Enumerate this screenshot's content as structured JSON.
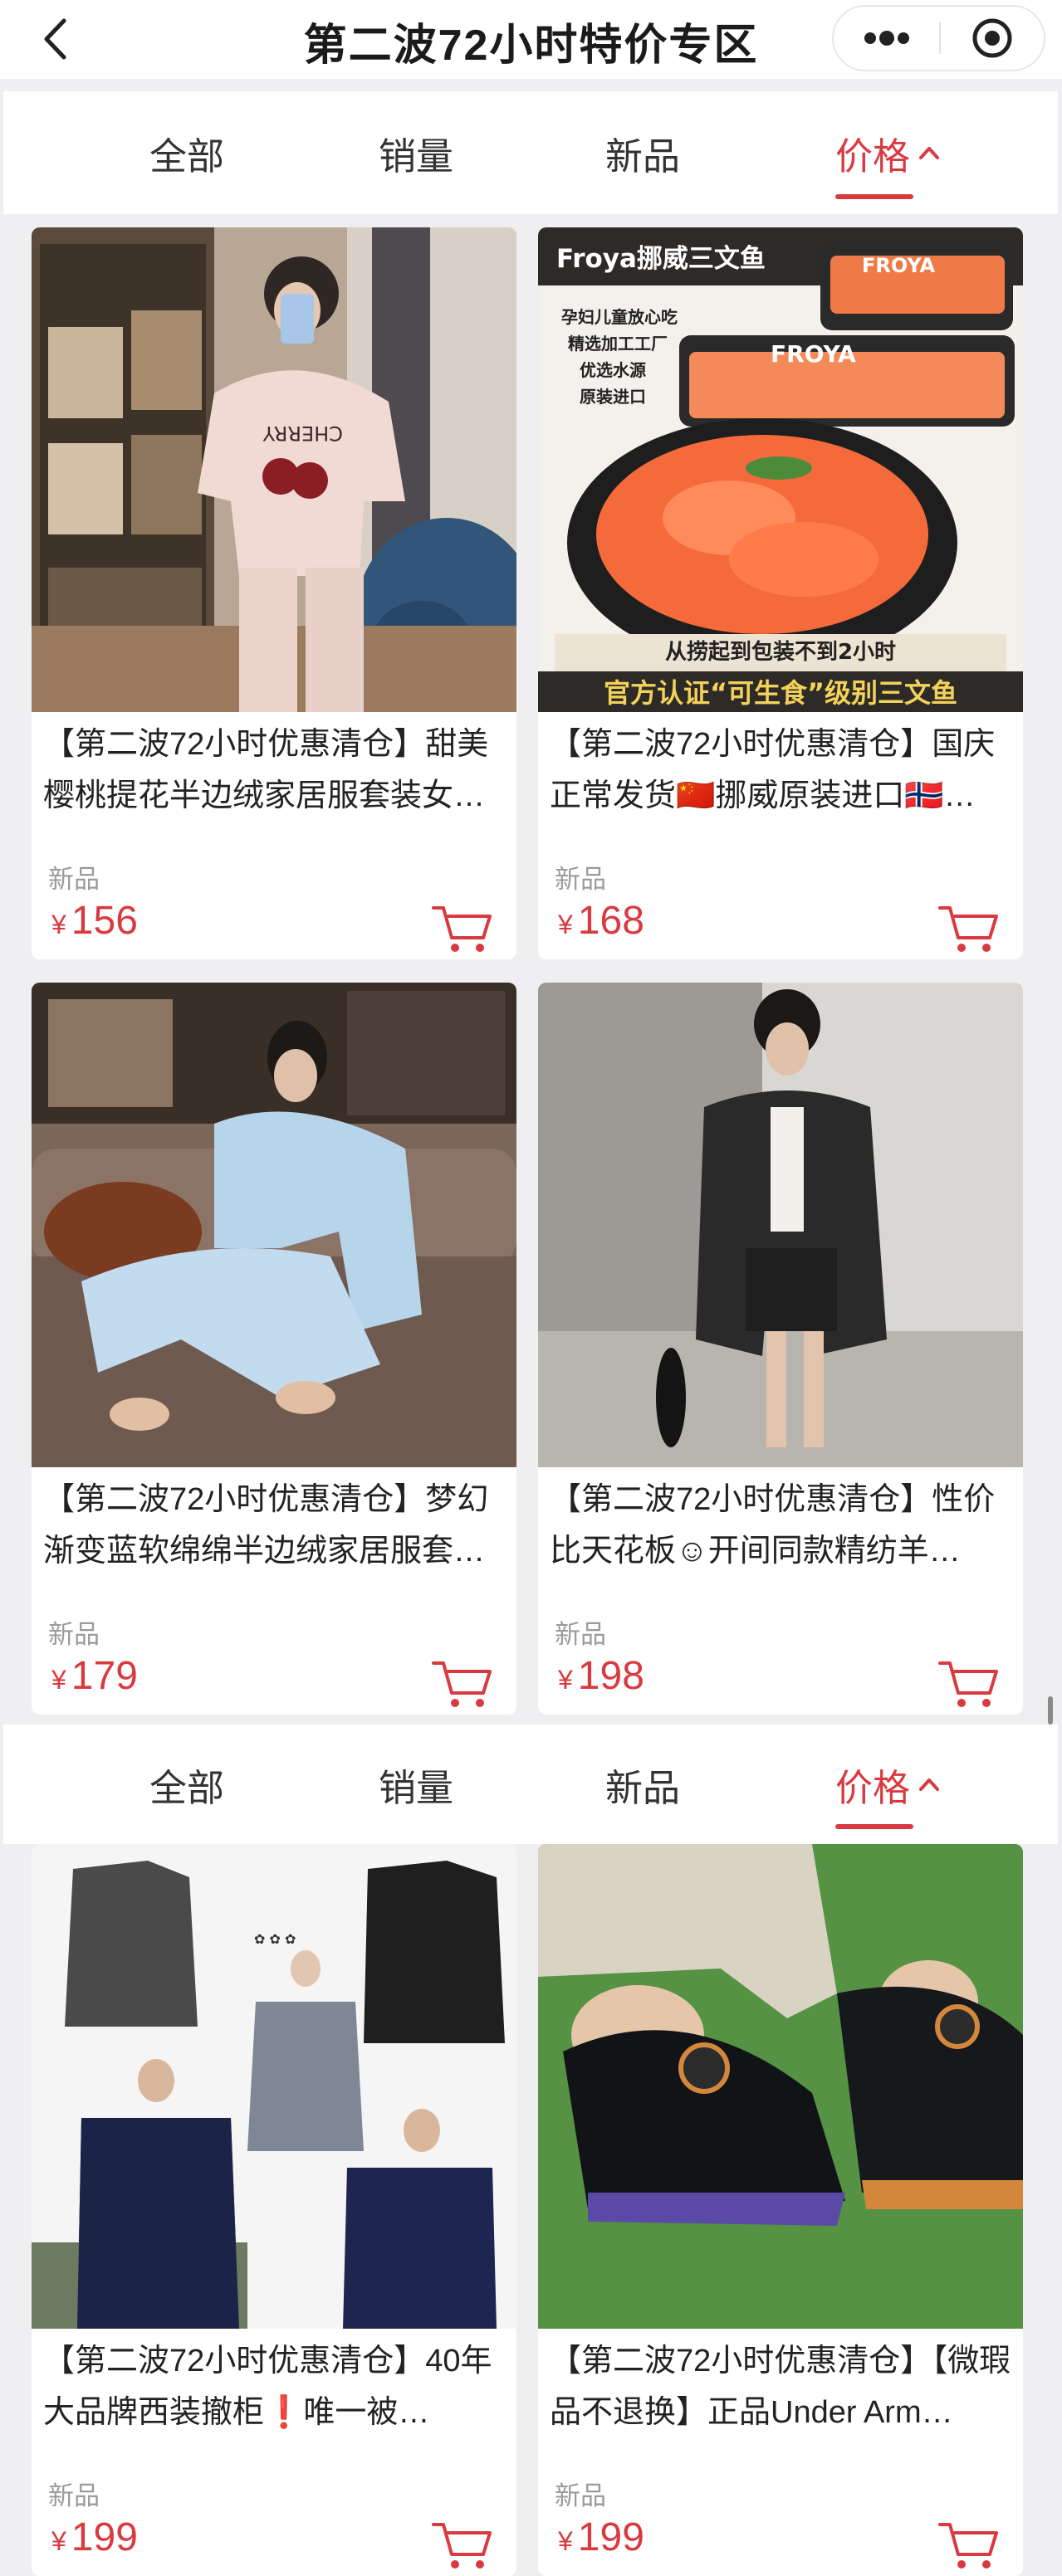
{
  "header": {
    "title": "第二波72小时特价专区",
    "back_icon": "chevron-left-icon",
    "more_icon": "more-dots-icon",
    "close_icon": "mini-program-close-icon"
  },
  "tabs": [
    {
      "label": "全部",
      "active": false
    },
    {
      "label": "销量",
      "active": false
    },
    {
      "label": "新品",
      "active": false
    },
    {
      "label": "价格",
      "active": true,
      "sort_icon": "chevron-up-icon"
    }
  ],
  "accent_color": "#d93a3f",
  "products": [
    {
      "title": "【第二波72小时优惠清仓】甜美樱桃提花半边绒家居服套装女…",
      "tag": "新品",
      "currency": "¥",
      "price": "156",
      "image": "woman-pink-cherry-loungewear-photo"
    },
    {
      "title": "【第二波72小时优惠清仓】国庆正常发货🇨🇳挪威原装进口🇳🇴…",
      "tag": "新品",
      "currency": "¥",
      "price": "168",
      "image": "froya-norwegian-salmon-photo",
      "image_text": {
        "brand": "Froya挪威三文鱼",
        "logo": "FROYA",
        "bullets": [
          "孕妇儿童放心吃",
          "精选加工工厂",
          "优选水源",
          "原装进口"
        ],
        "caption1": "从捞起到包装不到2小时",
        "caption2": "官方认证“可生食”级别三文鱼"
      }
    },
    {
      "title": "【第二波72小时优惠清仓】梦幻渐变蓝软绵绵半边绒家居服套…",
      "tag": "新品",
      "currency": "¥",
      "price": "179",
      "image": "woman-blue-loungewear-sofa-photo"
    },
    {
      "title": "【第二波72小时优惠清仓】性价比天花板☺开间同款精纺羊…",
      "tag": "新品",
      "currency": "¥",
      "price": "198",
      "image": "woman-black-blazer-skirt-photo"
    },
    {
      "title": "【第二波72小时优惠清仓】40年大品牌西装撤柜❗唯一被…",
      "tag": "新品",
      "currency": "¥",
      "price": "199",
      "image": "men-suit-jackets-collage-photo"
    },
    {
      "title": "【第二波72小时优惠清仓】【微瑕品不退换】正品Under Arm…",
      "tag": "新品",
      "currency": "¥",
      "price": "199",
      "image": "black-golf-shoes-on-grass-photo"
    }
  ]
}
